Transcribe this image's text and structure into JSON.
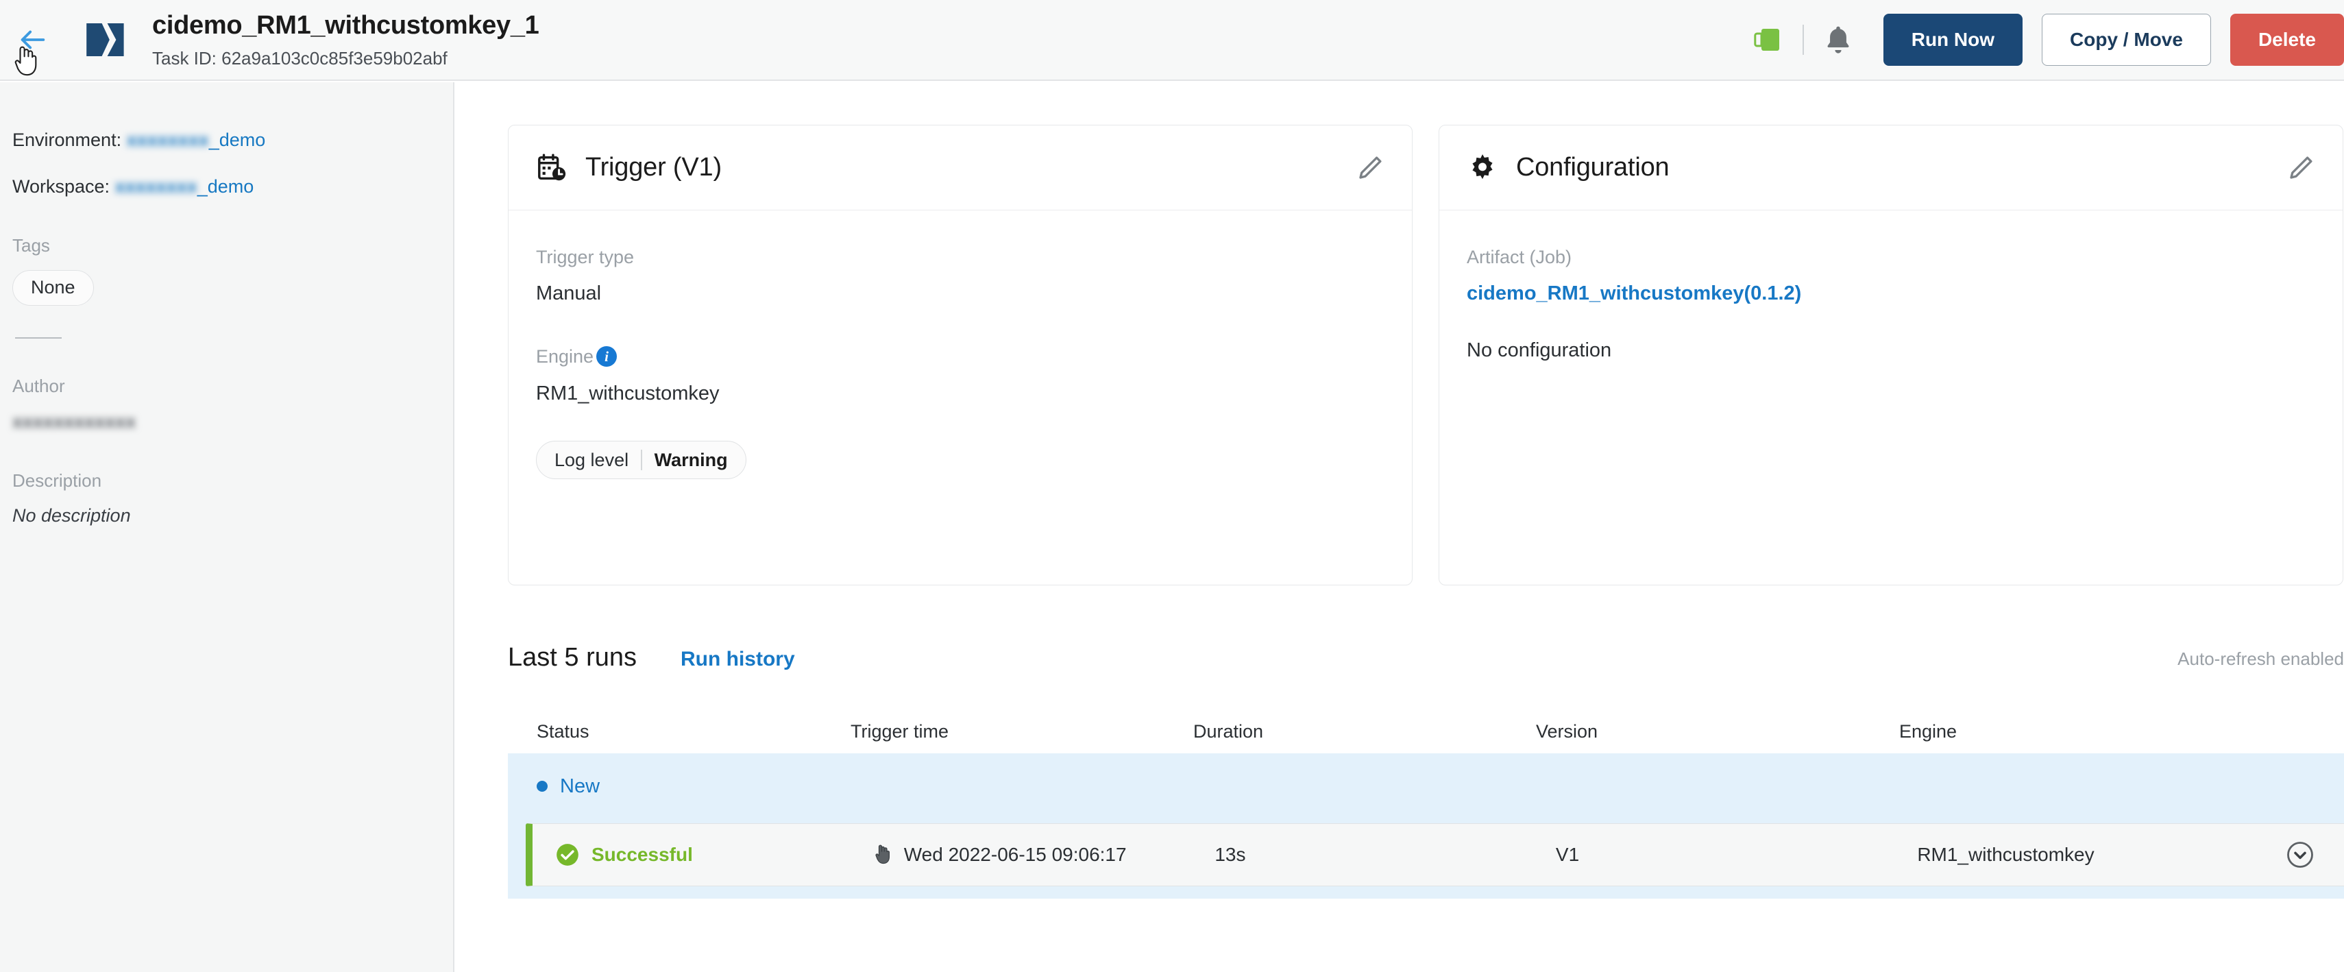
{
  "header": {
    "back_icon": "arrow-left-icon",
    "logo_icon": "brand-chevron-logo",
    "title": "cidemo_RM1_withcustomkey_1",
    "task_id": "Task ID: 62a9a103c0c85f3e59b02abf",
    "status_icon": "green-battery-icon",
    "bell_icon": "notification-bell-icon",
    "run_now_label": "Run Now",
    "copy_move_label": "Copy / Move",
    "delete_label": "Delete",
    "colors": {
      "primary": "#1b4876",
      "danger": "#d9584f",
      "link": "#1778c5"
    }
  },
  "sidebar": {
    "environment_label": "Environment:",
    "environment_value_redacted": "xxxxxxxx",
    "environment_value_suffix": "_demo",
    "workspace_label": "Workspace:",
    "workspace_value_redacted": "xxxxxxxx",
    "workspace_value_suffix": "_demo",
    "tags_label": "Tags",
    "tags_value": "None",
    "author_label": "Author",
    "author_value_redacted": "xxxxxxxxxxxx",
    "description_label": "Description",
    "description_value": "No description"
  },
  "trigger_card": {
    "icon": "calendar-clock-icon",
    "title": "Trigger (V1)",
    "edit_icon": "pencil-icon",
    "trigger_type_label": "Trigger type",
    "trigger_type_value": "Manual",
    "engine_label": "Engine",
    "engine_info_icon": "info-icon",
    "engine_value": "RM1_withcustomkey",
    "log_level_label": "Log level",
    "log_level_value": "Warning"
  },
  "config_card": {
    "icon": "gear-icon",
    "title": "Configuration",
    "edit_icon": "pencil-icon",
    "artifact_label": "Artifact (Job)",
    "artifact_link": "cidemo_RM1_withcustomkey(0.1.2)",
    "no_configuration": "No configuration"
  },
  "runs": {
    "title": "Last 5 runs",
    "history_link": "Run history",
    "auto_refresh": "Auto-refresh enabled",
    "columns": [
      "Status",
      "Trigger time",
      "Duration",
      "Version",
      "Engine"
    ],
    "group_label": "New",
    "rows": [
      {
        "status": "Successful",
        "status_icon": "check-circle-icon",
        "trigger_time": "Wed 2022-06-15 09:06:17",
        "duration": "13s",
        "version": "V1",
        "engine": "RM1_withcustomkey",
        "expand_icon": "chevron-down-circle-icon"
      }
    ]
  }
}
